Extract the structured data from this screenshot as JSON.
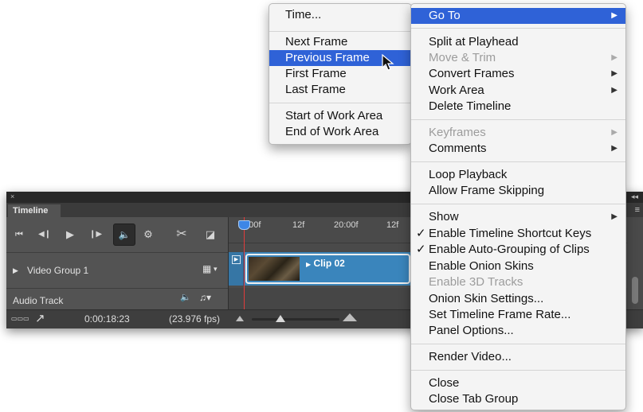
{
  "left_menu": {
    "items": [
      {
        "label": "Time...",
        "state": "normal"
      },
      {
        "label": "Next Frame",
        "state": "normal"
      },
      {
        "label": "Previous Frame",
        "state": "highlighted"
      },
      {
        "label": "First Frame",
        "state": "normal"
      },
      {
        "label": "Last Frame",
        "state": "normal"
      },
      {
        "label": "Start of Work Area",
        "state": "normal"
      },
      {
        "label": "End of Work Area",
        "state": "normal"
      }
    ]
  },
  "right_menu": {
    "items": [
      {
        "label": "Go To",
        "state": "highlighted",
        "submenu": true
      },
      {
        "label": "Split at Playhead",
        "state": "normal"
      },
      {
        "label": "Move & Trim",
        "state": "disabled",
        "submenu": true
      },
      {
        "label": "Convert Frames",
        "state": "normal",
        "submenu": true
      },
      {
        "label": "Work Area",
        "state": "normal",
        "submenu": true
      },
      {
        "label": "Delete Timeline",
        "state": "normal"
      },
      {
        "label": "Keyframes",
        "state": "disabled",
        "submenu": true
      },
      {
        "label": "Comments",
        "state": "normal",
        "submenu": true
      },
      {
        "label": "Loop Playback",
        "state": "normal"
      },
      {
        "label": "Allow Frame Skipping",
        "state": "normal"
      },
      {
        "label": "Show",
        "state": "normal",
        "submenu": true
      },
      {
        "label": "Enable Timeline Shortcut Keys",
        "state": "normal",
        "checked": true
      },
      {
        "label": "Enable Auto-Grouping of Clips",
        "state": "normal",
        "checked": true
      },
      {
        "label": "Enable Onion Skins",
        "state": "normal"
      },
      {
        "label": "Enable 3D Tracks",
        "state": "disabled"
      },
      {
        "label": "Onion Skin Settings...",
        "state": "normal"
      },
      {
        "label": "Set Timeline Frame Rate...",
        "state": "normal"
      },
      {
        "label": "Panel Options...",
        "state": "normal"
      },
      {
        "label": "Render Video...",
        "state": "normal"
      },
      {
        "label": "Close",
        "state": "normal"
      },
      {
        "label": "Close Tab Group",
        "state": "normal"
      }
    ]
  },
  "timeline": {
    "tab_label": "Timeline",
    "close_glyph": "×",
    "collapse_glyph": "◂◂",
    "menu_glyph": "≡",
    "controls": {
      "first": "⏮",
      "prev": "◀❙",
      "play": "▶",
      "next": "❙▶",
      "audio": "🔈",
      "settings": "⚙",
      "split": "✂",
      "transition": "◪"
    },
    "ruler_ticks": [
      "1:00f",
      "12f",
      "20:00f",
      "12f"
    ],
    "video_group_label": "Video Group 1",
    "video_group_menu": "▾",
    "audio_track_label": "Audio Track",
    "audio_icon": "🔈",
    "music_icon": "♫▾",
    "clip_name": "Clip 02",
    "clip_arrow": "▶",
    "timecode": "0:00:18:23",
    "fps": "(23.976 fps)",
    "render_icon": "▭▭▭",
    "export_arrow": "↗",
    "zoom_percent": 0.33
  },
  "icons": {
    "submenu_arrow": "▶",
    "checkmark": "✓",
    "cursor": "arrow-cursor"
  },
  "colors": {
    "highlight": "#2f62d7",
    "clip_blue": "#3c84b7",
    "playhead": "#e03c3c"
  }
}
